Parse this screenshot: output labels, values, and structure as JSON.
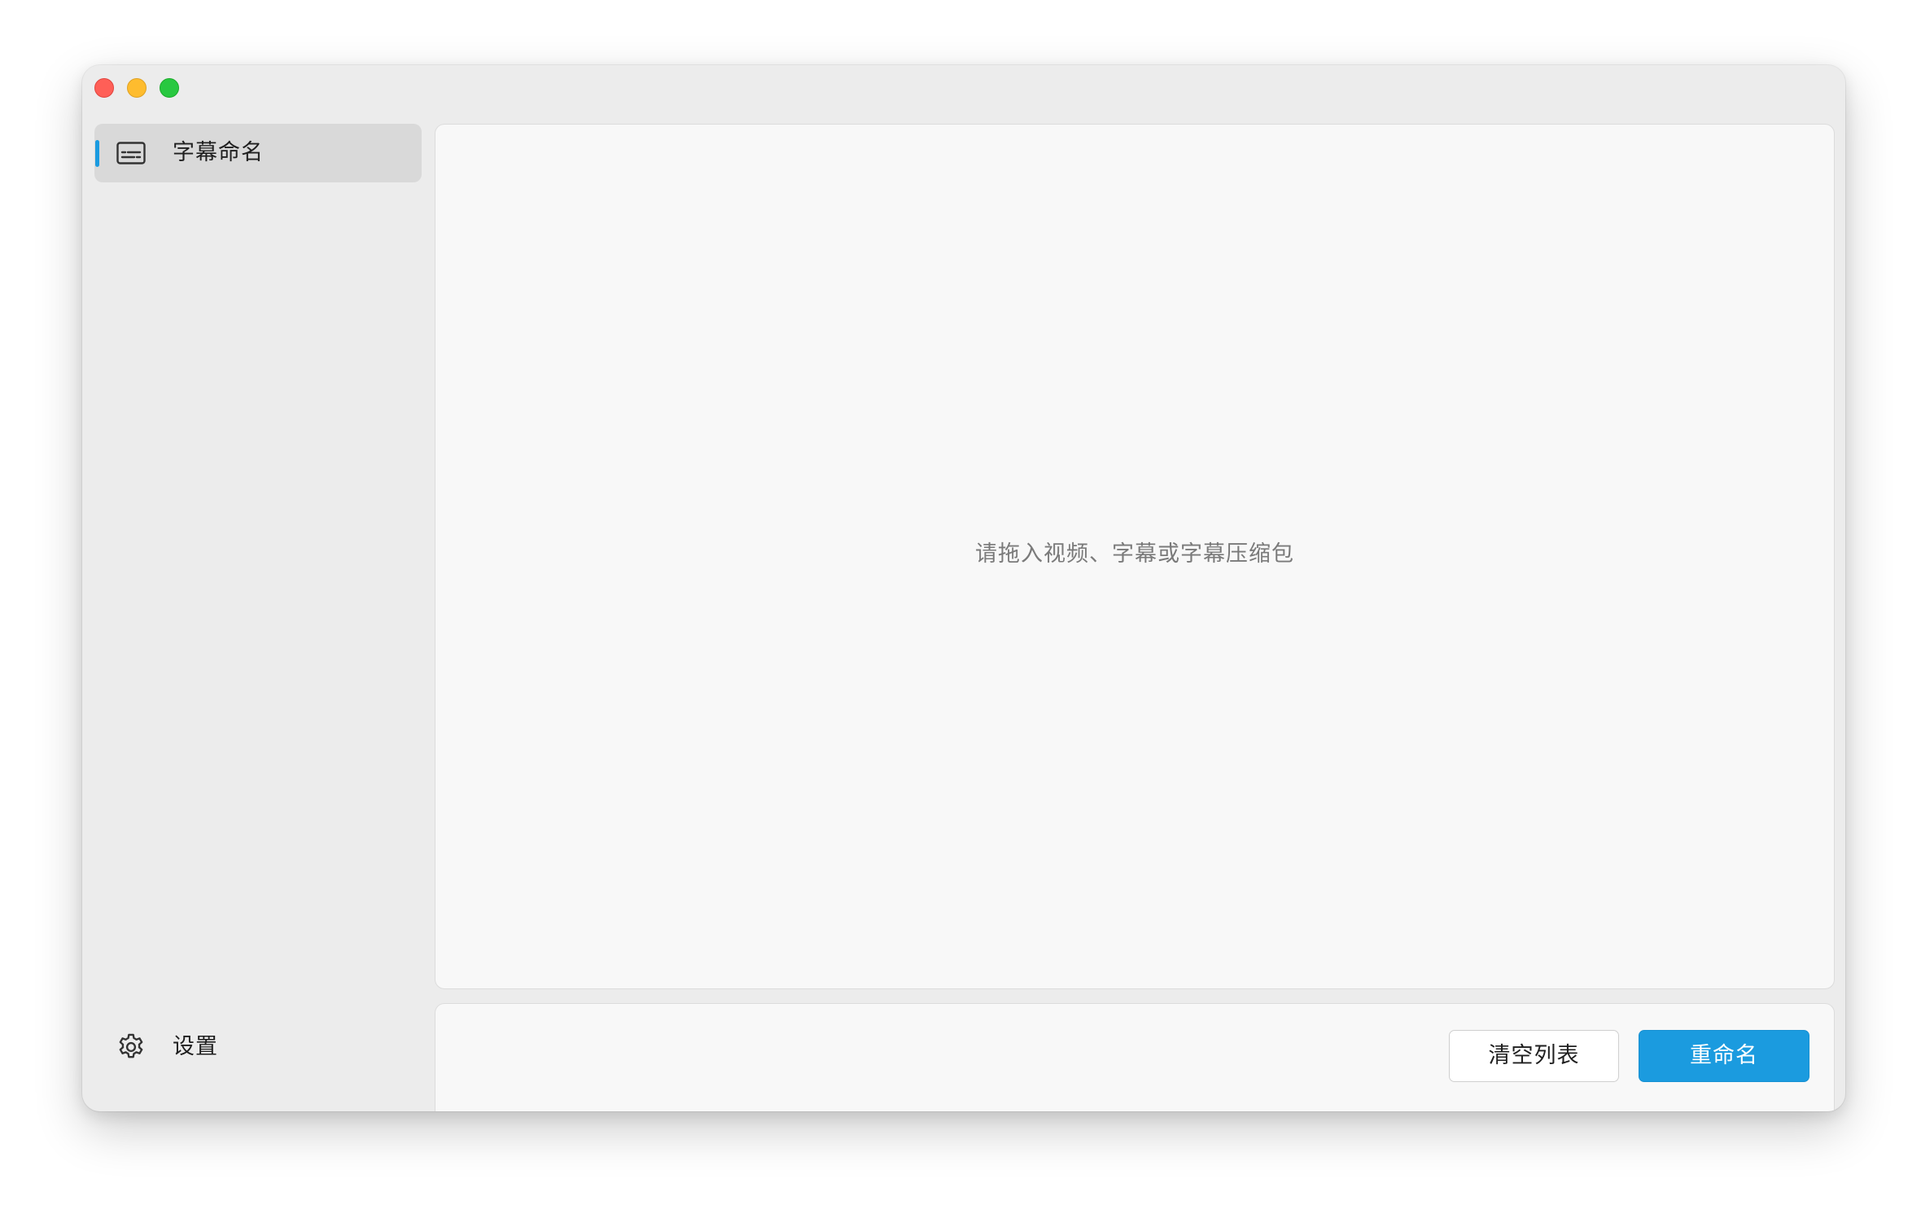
{
  "window": {
    "controls": {
      "close_color": "#ff5f57",
      "minimize_color": "#febc2e",
      "zoom_color": "#28c840"
    }
  },
  "sidebar": {
    "items": [
      {
        "label": "字幕命名",
        "icon": "subtitles-icon",
        "selected": true
      }
    ],
    "footer": {
      "label": "设置",
      "icon": "gear-icon"
    },
    "accent_color": "#1a9be0"
  },
  "main": {
    "drop_zone": {
      "hint": "请拖入视频、字幕或字幕压缩包"
    }
  },
  "actions": {
    "clear_label": "清空列表",
    "rename_label": "重命名",
    "primary_color": "#1b9bdf"
  }
}
